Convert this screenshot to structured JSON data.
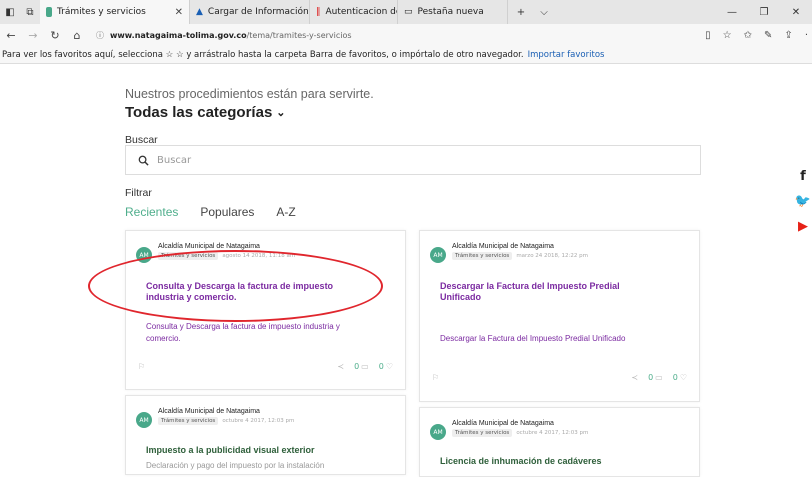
{
  "browser": {
    "tabs": [
      {
        "label": "Trámites y servicios"
      },
      {
        "label": "Cargar de Información - Fac"
      },
      {
        "label": "Autenticacion de usuarios"
      },
      {
        "label": "Pestaña nueva"
      }
    ],
    "address_host": "www.natagaima-tolima.gov.co",
    "address_path": "/tema/tramites-y-servicios",
    "favorites_text": "Para ver los favoritos aquí, selecciona ☆ ☆ y arrástralo hasta la carpeta Barra de favoritos, o impórtalo de otro navegador.",
    "favorites_link": "Importar favoritos"
  },
  "page": {
    "subtitle": "Nuestros procedimientos están para servirte.",
    "heading": "Todas las categorías",
    "search_label": "Buscar",
    "search_placeholder": "Buscar",
    "filter_label": "Filtrar",
    "filters": [
      "Recientes",
      "Populares",
      "A-Z"
    ]
  },
  "cards": [
    {
      "avatar": "AM",
      "author": "Alcaldía Municipal de Natagaima",
      "tag": "Trámites y servicios",
      "date": "agosto 14 2018, 11:18 am",
      "title": "Consulta y Descarga la factura de impuesto industria y comercio.",
      "desc": "Consulta y Descarga la factura de impuesto industria y comercio.",
      "comments": "0",
      "likes": "0"
    },
    {
      "avatar": "AM",
      "author": "Alcaldía Municipal de Natagaima",
      "tag": "Trámites y servicios",
      "date": "marzo 24 2018, 12:22 pm",
      "title": "Descargar la Factura del Impuesto Predial Unificado",
      "desc": "Descargar la Factura del Impuesto Predial Unificado",
      "comments": "0",
      "likes": "0"
    },
    {
      "avatar": "AM",
      "author": "Alcaldía Municipal de Natagaima",
      "tag": "Trámites y servicios",
      "date": "octubre 4 2017, 12:03 pm",
      "title": "Impuesto a la publicidad visual exterior",
      "desc": "Declaración y pago del impuesto por la instalación"
    },
    {
      "avatar": "AM",
      "author": "Alcaldía Municipal de Natagaima",
      "tag": "Trámites y servicios",
      "date": "octubre 4 2017, 12:03 pm",
      "title": "Licencia de inhumación de cadáveres"
    }
  ],
  "colors": {
    "accent": "#4fae8c",
    "title_purple": "#7b2aa1",
    "annotation_red": "#e0262d"
  }
}
